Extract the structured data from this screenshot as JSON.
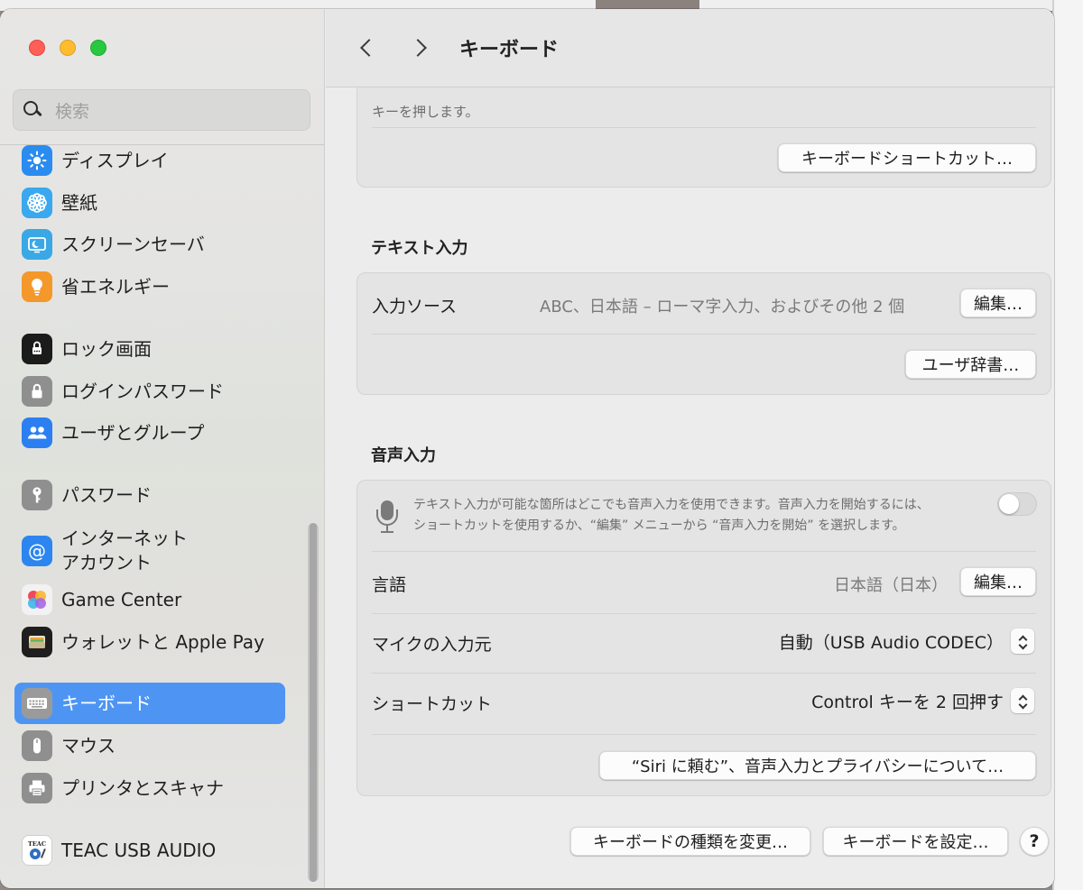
{
  "window": {
    "title": "キーボード"
  },
  "search": {
    "placeholder": "検索"
  },
  "sidebar": {
    "items": [
      {
        "label": "ディスプレイ",
        "icon": "sun-icon",
        "color": "#2b8cf0"
      },
      {
        "label": "壁紙",
        "icon": "flower-icon",
        "color": "#39a8ee"
      },
      {
        "label": "スクリーンセーバ",
        "icon": "screensaver-icon",
        "color": "#3aa8e5"
      },
      {
        "label": "省エネルギー",
        "icon": "lightbulb-icon",
        "color": "#f4982b"
      },
      {
        "label": "ロック画面",
        "icon": "lock-screen-icon",
        "color": "#1b1b1b"
      },
      {
        "label": "ログインパスワード",
        "icon": "lock-icon",
        "color": "#8f8f8f"
      },
      {
        "label": "ユーザとグループ",
        "icon": "users-icon",
        "color": "#2c7ff0"
      },
      {
        "label": "パスワード",
        "icon": "key-icon",
        "color": "#8f8f8f"
      },
      {
        "label": "インターネット\nアカウント",
        "label_line1": "インターネット",
        "label_line2": "アカウント",
        "icon": "at-icon",
        "color": "#2d86ef"
      },
      {
        "label": "Game Center",
        "icon": "game-center-icon",
        "color": "#f0f0f0"
      },
      {
        "label": "ウォレットと Apple Pay",
        "icon": "wallet-icon",
        "color": "#1e1e1e"
      },
      {
        "label": "キーボード",
        "icon": "keyboard-icon",
        "color": "#9a9a9a",
        "selected": true
      },
      {
        "label": "マウス",
        "icon": "mouse-icon",
        "color": "#8f8f8f"
      },
      {
        "label": "プリンタとスキャナ",
        "icon": "printer-icon",
        "color": "#8f8f8f"
      },
      {
        "label": "TEAC USB AUDIO",
        "icon": "teac-audio-icon",
        "color": "#ffffff"
      }
    ],
    "selected_color": "#4e95f3"
  },
  "keyboard": {
    "top_hint": "キーを押します。",
    "shortcuts_button": "キーボードショートカット…",
    "text_input": {
      "heading": "テキスト入力",
      "source_label": "入力ソース",
      "source_value": "ABC、日本語 – ローマ字入力、およびその他 2 個",
      "edit_button": "編集…",
      "user_dict_button": "ユーザ辞書…"
    },
    "dictation": {
      "heading": "音声入力",
      "description_line1": "テキスト入力が可能な箇所はどこでも音声入力を使用できます。音声入力を開始するには、",
      "description_line2": "ショートカットを使用するか、“編集” メニューから “音声入力を開始” を選択します。",
      "enabled": false,
      "language_label": "言語",
      "language_value": "日本語（日本）",
      "language_edit_button": "編集…",
      "mic_label": "マイクの入力元",
      "mic_value": "自動（USB Audio CODEC）",
      "shortcut_label": "ショートカット",
      "shortcut_value": "Control キーを 2 回押す",
      "siri_button": "“Siri に頼む”、音声入力とプライバシーについて…"
    },
    "footer": {
      "change_type_button": "キーボードの種類を変更…",
      "setup_button": "キーボードを設定…",
      "help_button": "?"
    }
  }
}
